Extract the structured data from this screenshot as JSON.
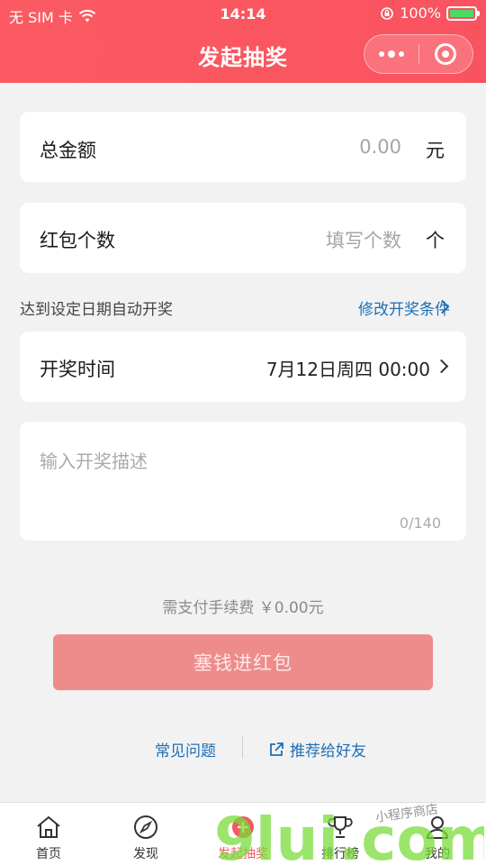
{
  "status_bar": {
    "carrier": "无 SIM 卡",
    "time": "14:14",
    "battery": "100%"
  },
  "header": {
    "title": "发起抽奖"
  },
  "amount": {
    "label": "总金额",
    "value": "0.00",
    "unit": "元"
  },
  "count": {
    "label": "红包个数",
    "placeholder": "填写个数",
    "unit": "个"
  },
  "hint": {
    "text": "达到设定日期自动开奖",
    "modify_link": "修改开奖条件"
  },
  "draw_time": {
    "label": "开奖时间",
    "value": "7月12日周四 00:00"
  },
  "description": {
    "placeholder": "输入开奖描述",
    "counter": "0/140"
  },
  "fee": {
    "text": "需支付手续费 ￥0.00元"
  },
  "submit": {
    "label": "塞钱进红包"
  },
  "links": {
    "faq": "常见问题",
    "share": "推荐给好友"
  },
  "tabbar": {
    "items": [
      {
        "label": "首页",
        "icon": "home-icon"
      },
      {
        "label": "发现",
        "icon": "compass-icon"
      },
      {
        "label": "发起抽奖",
        "icon": "plus-circle-icon",
        "active": true
      },
      {
        "label": "排行榜",
        "icon": "trophy-icon"
      },
      {
        "label": "我的",
        "icon": "user-icon"
      }
    ]
  },
  "watermark": {
    "text": "9lui.com",
    "subtext": "小程序商店"
  },
  "colors": {
    "brand": "#f9535f",
    "link": "#1e6fb5",
    "button": "#ee8c8c",
    "background": "#f2f2f2"
  }
}
